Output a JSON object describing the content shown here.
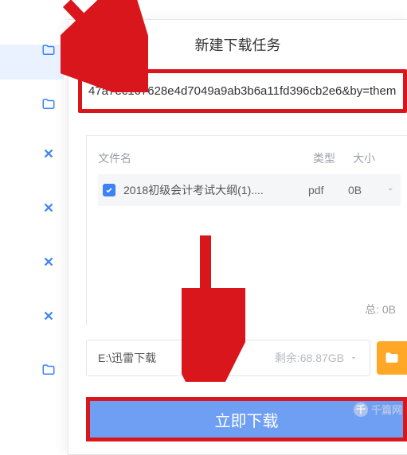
{
  "modal": {
    "title": "新建下载任务",
    "url_fragment": "47a7ec167628e4d7049a9ab3b6a11fd396cb2e6&by=them"
  },
  "file_table": {
    "headers": {
      "name": "文件名",
      "type": "类型",
      "size": "大小"
    },
    "rows": [
      {
        "checked": true,
        "name": "2018初级会计考试大纲(1)....",
        "type": "pdf",
        "size": "0B"
      }
    ],
    "total_label": "总:  0B"
  },
  "path": {
    "value": "E:\\迅雷下载",
    "remaining_label": "剩余:68.87GB"
  },
  "actions": {
    "download": "立即下载"
  },
  "watermark": {
    "symbol": "千",
    "text": "千篇网"
  }
}
